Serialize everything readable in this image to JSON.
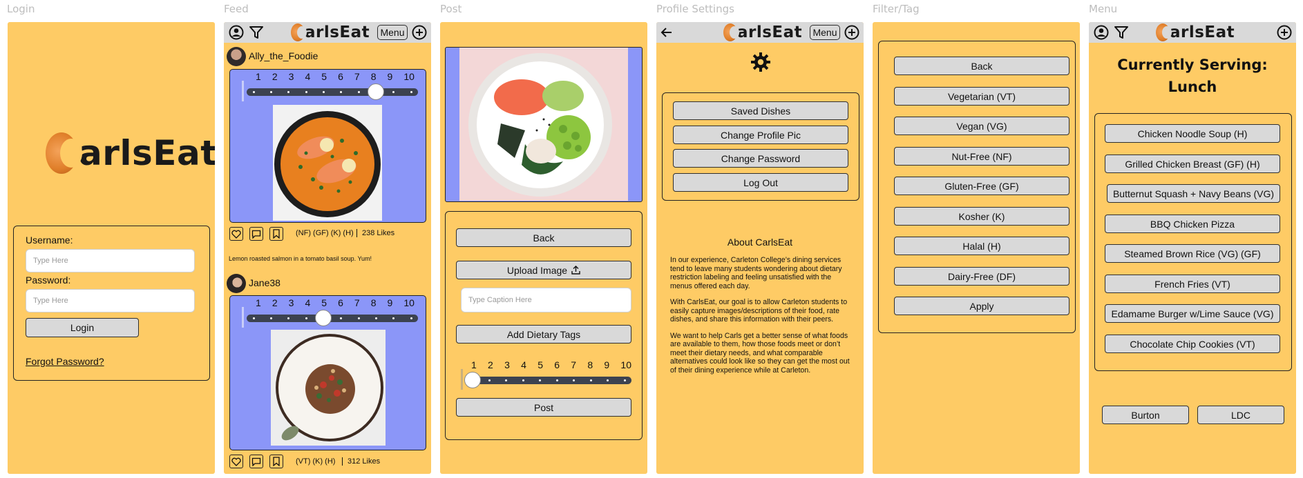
{
  "frames": {
    "login": "Login",
    "feed": "Feed",
    "post": "Post",
    "profile": "Profile Settings",
    "filter": "Filter/Tag",
    "menu": "Menu"
  },
  "brand": {
    "logo_rest": "arlsEat",
    "accent": "#fecb65",
    "bar": "#d9d9d9",
    "card": "#8b96f8"
  },
  "login": {
    "username_label": "Username:",
    "username_placeholder": "Type Here",
    "password_label": "Password:",
    "password_placeholder": "Type Here",
    "login_button": "Login",
    "forgot": "Forgot Password?"
  },
  "feed": {
    "menu_button": "Menu",
    "scale": [
      "1",
      "2",
      "3",
      "4",
      "5",
      "6",
      "7",
      "8",
      "9",
      "10"
    ],
    "posts": [
      {
        "user": "Ally_the_Foodie",
        "rating": 8,
        "tags": "(NF) (GF) (K) (H)",
        "likes": "238 Likes",
        "caption": "Lemon roasted salmon in a tomato basil soup. Yum!"
      },
      {
        "user": "Jane38",
        "rating": 5,
        "tags": "(VT) (K) (H)",
        "likes": "312 Likes"
      }
    ]
  },
  "post": {
    "back": "Back",
    "upload": "Upload Image",
    "caption_placeholder": "Type Caption Here",
    "add_tags": "Add Dietary Tags",
    "scale": [
      "1",
      "2",
      "3",
      "4",
      "5",
      "6",
      "7",
      "8",
      "9",
      "10"
    ],
    "rating": 1,
    "post_button": "Post"
  },
  "profile": {
    "menu_button": "Menu",
    "buttons": [
      "Saved Dishes",
      "Change Profile Pic",
      "Change Password",
      "Log Out"
    ],
    "about_title": "About CarlsEat",
    "about_paragraphs": [
      "In our experience, Carleton College’s dining services tend to leave many students wondering about dietary restriction labeling and feeling unsatisfied with the menus offered each day.",
      "With CarlsEat, our goal is to allow Carleton students to easily capture images/descriptions of their food, rate dishes, and share this information with their peers.",
      "We want to help Carls get a better sense of what foods are available to them, how those foods meet or don’t meet their dietary needs, and what comparable alternatives could look like so they can get the most out of their dining experience while at Carleton."
    ]
  },
  "filter": {
    "buttons": [
      "Back",
      "Vegetarian (VT)",
      "Vegan (VG)",
      "Nut-Free (NF)",
      "Gluten-Free (GF)",
      "Kosher (K)",
      "Halal (H)",
      "Dairy-Free (DF)",
      "Apply"
    ]
  },
  "menu": {
    "heading_1": "Currently Serving:",
    "heading_2": "Lunch",
    "items": [
      "Chicken Noodle Soup (H)",
      "Grilled Chicken Breast (GF) (H)",
      "Butternut Squash + Navy Beans (VG)",
      "BBQ Chicken Pizza",
      "Steamed Brown Rice (VG) (GF)",
      "French Fries (VT)",
      "Edamame Burger w/Lime Sauce (VG)",
      "Chocolate Chip Cookies (VT)"
    ],
    "halls": [
      "Burton",
      "LDC"
    ]
  }
}
